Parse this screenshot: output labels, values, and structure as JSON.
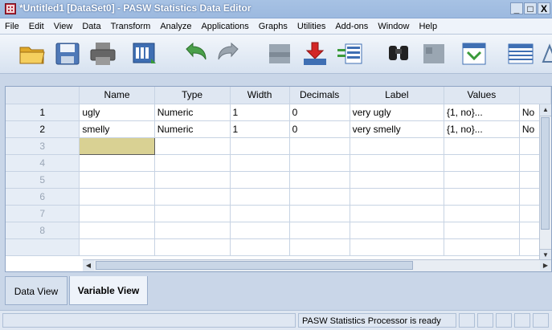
{
  "window": {
    "title": "*Untitled1 [DataSet0] - PASW Statistics Data Editor",
    "minimize": "_",
    "restore": "□",
    "close": "X"
  },
  "menu": [
    "File",
    "Edit",
    "View",
    "Data",
    "Transform",
    "Analyze",
    "Applications",
    "Graphs",
    "Utilities",
    "Add-ons",
    "Window",
    "Help"
  ],
  "toolbar": [
    "open-folder-icon",
    "save-icon",
    "print-icon",
    "dialog-recall-icon",
    "undo-icon",
    "redo-icon",
    "goto-case-icon",
    "goto-variable-icon",
    "variables-icon",
    "find-icon",
    "insert-cases-icon",
    "split-file-icon",
    "weight-cases-icon",
    "value-labels-icon"
  ],
  "grid": {
    "columns": [
      "Name",
      "Type",
      "Width",
      "Decimals",
      "Label",
      "Values",
      ""
    ],
    "rows": [
      {
        "num": "1",
        "cells": [
          "ugly",
          "Numeric",
          "1",
          "0",
          "very ugly",
          "{1, no}...",
          "No"
        ]
      },
      {
        "num": "2",
        "cells": [
          "smelly",
          "Numeric",
          "1",
          "0",
          "very smelly",
          "{1, no}...",
          "No"
        ]
      },
      {
        "num": "3",
        "cells": [
          "",
          "",
          "",
          "",
          "",
          "",
          ""
        ]
      },
      {
        "num": "4",
        "cells": [
          "",
          "",
          "",
          "",
          "",
          "",
          ""
        ]
      },
      {
        "num": "5",
        "cells": [
          "",
          "",
          "",
          "",
          "",
          "",
          ""
        ]
      },
      {
        "num": "6",
        "cells": [
          "",
          "",
          "",
          "",
          "",
          "",
          ""
        ]
      },
      {
        "num": "7",
        "cells": [
          "",
          "",
          "",
          "",
          "",
          "",
          ""
        ]
      },
      {
        "num": "8",
        "cells": [
          "",
          "",
          "",
          "",
          "",
          "",
          ""
        ]
      }
    ]
  },
  "tabs": {
    "data_view": "Data View",
    "variable_view": "Variable View"
  },
  "status": {
    "processor": "PASW Statistics Processor is ready"
  },
  "colors": {
    "selected_cell": "#d9d193",
    "title_bar": "#9cb9df"
  }
}
